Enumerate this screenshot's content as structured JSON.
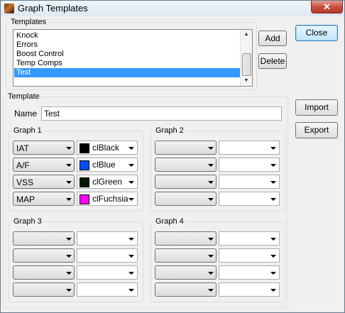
{
  "window": {
    "title": "Graph Templates",
    "close_glyph": "✕"
  },
  "templates_group": {
    "legend": "Templates",
    "items": [
      "Knock",
      "Errors",
      "Boost Control",
      "Temp Comps",
      "Test"
    ],
    "selected_index": 4
  },
  "buttons": {
    "add": "Add",
    "delete": "Delete",
    "close": "Close",
    "import": "Import",
    "export": "Export"
  },
  "template_group": {
    "legend": "Template",
    "name_label": "Name",
    "name_value": "Test"
  },
  "graphs": [
    {
      "legend": "Graph 1",
      "rows": [
        {
          "channel": "IAT",
          "color_name": "clBlack",
          "color_hex": "#000000"
        },
        {
          "channel": "A/F",
          "color_name": "clBlue",
          "color_hex": "#0050ff"
        },
        {
          "channel": "VSS",
          "color_name": "clGreen",
          "color_hex": "#001a00"
        },
        {
          "channel": "MAP",
          "color_name": "clFuchsia",
          "color_hex": "#ff00ff"
        }
      ]
    },
    {
      "legend": "Graph 2",
      "rows": [
        {
          "channel": "",
          "color_name": "",
          "color_hex": ""
        },
        {
          "channel": "",
          "color_name": "",
          "color_hex": ""
        },
        {
          "channel": "",
          "color_name": "",
          "color_hex": ""
        },
        {
          "channel": "",
          "color_name": "",
          "color_hex": ""
        }
      ]
    },
    {
      "legend": "Graph 3",
      "rows": [
        {
          "channel": "",
          "color_name": "",
          "color_hex": ""
        },
        {
          "channel": "",
          "color_name": "",
          "color_hex": ""
        },
        {
          "channel": "",
          "color_name": "",
          "color_hex": ""
        },
        {
          "channel": "",
          "color_name": "",
          "color_hex": ""
        }
      ]
    },
    {
      "legend": "Graph 4",
      "rows": [
        {
          "channel": "",
          "color_name": "",
          "color_hex": ""
        },
        {
          "channel": "",
          "color_name": "",
          "color_hex": ""
        },
        {
          "channel": "",
          "color_name": "",
          "color_hex": ""
        },
        {
          "channel": "",
          "color_name": "",
          "color_hex": ""
        }
      ]
    }
  ]
}
